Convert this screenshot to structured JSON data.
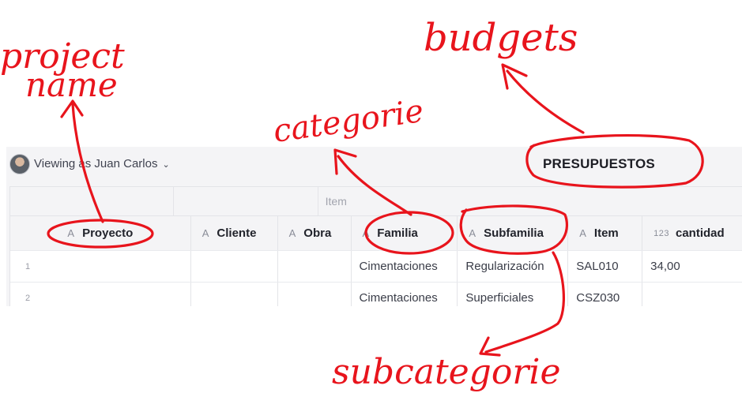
{
  "toolbar": {
    "viewing_label": "Viewing as Juan Carlos",
    "chevron_icon": "chevron-down-icon"
  },
  "page": {
    "title": "PRESUPUESTOS"
  },
  "table": {
    "group_label": "Item",
    "columns": [
      {
        "type_icon": "A",
        "label": "Proyecto"
      },
      {
        "type_icon": "A",
        "label": "Cliente"
      },
      {
        "type_icon": "A",
        "label": "Obra"
      },
      {
        "type_icon": "A",
        "label": "Familia"
      },
      {
        "type_icon": "A",
        "label": "Subfamilia"
      },
      {
        "type_icon": "A",
        "label": "Item"
      },
      {
        "type_icon": "123",
        "label": "cantidad"
      }
    ],
    "rows": [
      {
        "num": "1",
        "proyecto": "",
        "cliente": "",
        "obra": "",
        "familia": "Cimentaciones",
        "subfamilia": "Regularización",
        "item": "SAL010",
        "cantidad": "34,00"
      },
      {
        "num": "2",
        "proyecto": "",
        "cliente": "",
        "obra": "",
        "familia": "Cimentaciones",
        "subfamilia": "Superficiales",
        "item": "CSZ030",
        "cantidad": ""
      }
    ]
  },
  "annotations": {
    "project_name_line1": "project",
    "project_name_line2": "name",
    "categorie": "categorie",
    "budgets": "budgets",
    "subcategorie": "subcategorie",
    "ink_color": "#e8141c"
  }
}
